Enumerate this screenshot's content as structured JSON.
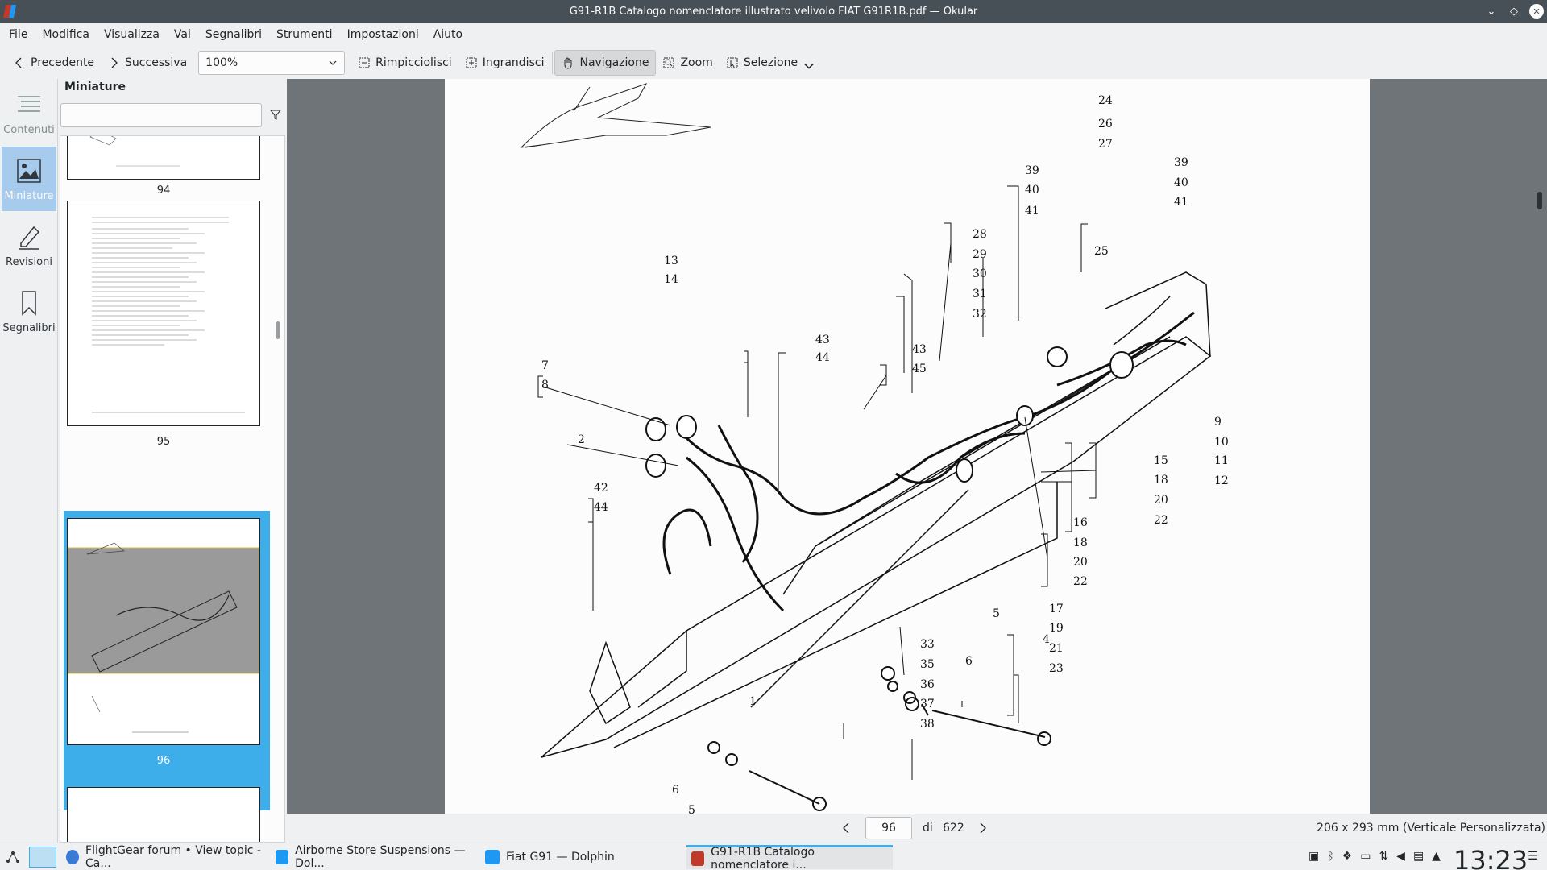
{
  "window": {
    "title": "G91-R1B Catalogo nomenclatore illustrato velivolo FIAT G91R1B.pdf — Okular"
  },
  "menu": [
    "File",
    "Modifica",
    "Visualizza",
    "Vai",
    "Segnalibri",
    "Strumenti",
    "Impostazioni",
    "Aiuto"
  ],
  "toolbar": {
    "prev": "Precedente",
    "next": "Successiva",
    "zoom": "100%",
    "zoom_out": "Rimpicciolisci",
    "zoom_in": "Ingrandisci",
    "browse": "Navigazione",
    "zoom_tool": "Zoom",
    "selection": "Selezione"
  },
  "sidebar": {
    "tabs": [
      "Contenuti",
      "Miniature",
      "Revisioni",
      "Segnalibri"
    ],
    "active": "Miniature"
  },
  "thumbnails": {
    "title": "Miniature",
    "search_placeholder": "",
    "pages": [
      "94",
      "95",
      "96"
    ]
  },
  "navigation": {
    "current_page": "96",
    "of": "di",
    "total": "622",
    "page_size": "206 x 293 mm (Verticale Personalizzata)"
  },
  "drawing_labels": [
    "1",
    "2",
    "4",
    "5",
    "5",
    "6",
    "6",
    "7",
    "8",
    "9",
    "10",
    "11",
    "12",
    "13",
    "14",
    "15",
    "16",
    "17",
    "18",
    "18",
    "19",
    "20",
    "20",
    "21",
    "22",
    "22",
    "23",
    "24",
    "25",
    "26",
    "27",
    "28",
    "29",
    "30",
    "31",
    "32",
    "33",
    "35",
    "36",
    "37",
    "38",
    "39",
    "39",
    "40",
    "40",
    "41",
    "41",
    "42",
    "43",
    "43",
    "44",
    "44",
    "45"
  ],
  "taskbar": {
    "tasks": [
      "FlightGear forum • View topic - Ca...",
      "Airborne Store Suspensions — Dol...",
      "Fiat G91 — Dolphin",
      "G91-R1B Catalogo nomenclatore i..."
    ],
    "clock": "13:23"
  },
  "colors": {
    "accent": "#3daee9",
    "titlebar": "#475057",
    "doc_background": "#6e7478"
  }
}
